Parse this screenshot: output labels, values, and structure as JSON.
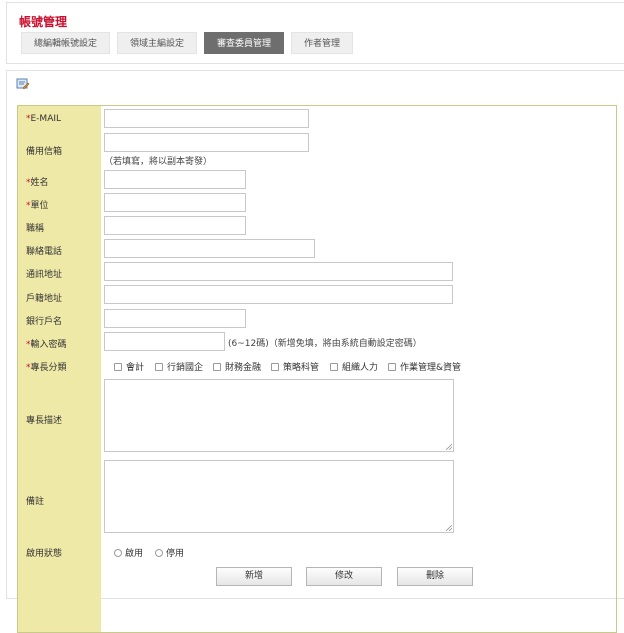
{
  "header": {
    "title": "帳號管理",
    "tabs": [
      "總編輯帳號設定",
      "領域主編設定",
      "審查委員管理",
      "作者管理"
    ]
  },
  "form": {
    "fields": {
      "email": "E-MAIL",
      "backup_email": "備用信箱",
      "backup_email_hint": "（若填寫，將以副本寄發）",
      "name": "姓名",
      "unit": "單位",
      "title": "職稱",
      "phone": "聯絡電話",
      "address": "通訊地址",
      "registered_address": "戶籍地址",
      "bank_account_name": "銀行戶名",
      "password": "輸入密碼",
      "password_hint": "(6~12碼)（新增免填，將由系統自動設定密碼）",
      "expertise_category": "專長分類",
      "expertise_description": "專長描述",
      "remarks": "備註",
      "status": "啟用狀態"
    },
    "required_mark": "*",
    "expertise_options": [
      "會計",
      "行銷國企",
      "財務金融",
      "策略科管",
      "組織人力",
      "作業管理&資管"
    ],
    "status_options": [
      "啟用",
      "停用"
    ]
  },
  "buttons": {
    "add": "新增",
    "edit": "修改",
    "delete": "刪除"
  },
  "colors": {
    "title_red": "#c8102e",
    "label_column_bg": "#efe9a8",
    "active_tab_bg": "#6e6e6e"
  },
  "icons": {
    "panel_icon": "edit-icon"
  }
}
